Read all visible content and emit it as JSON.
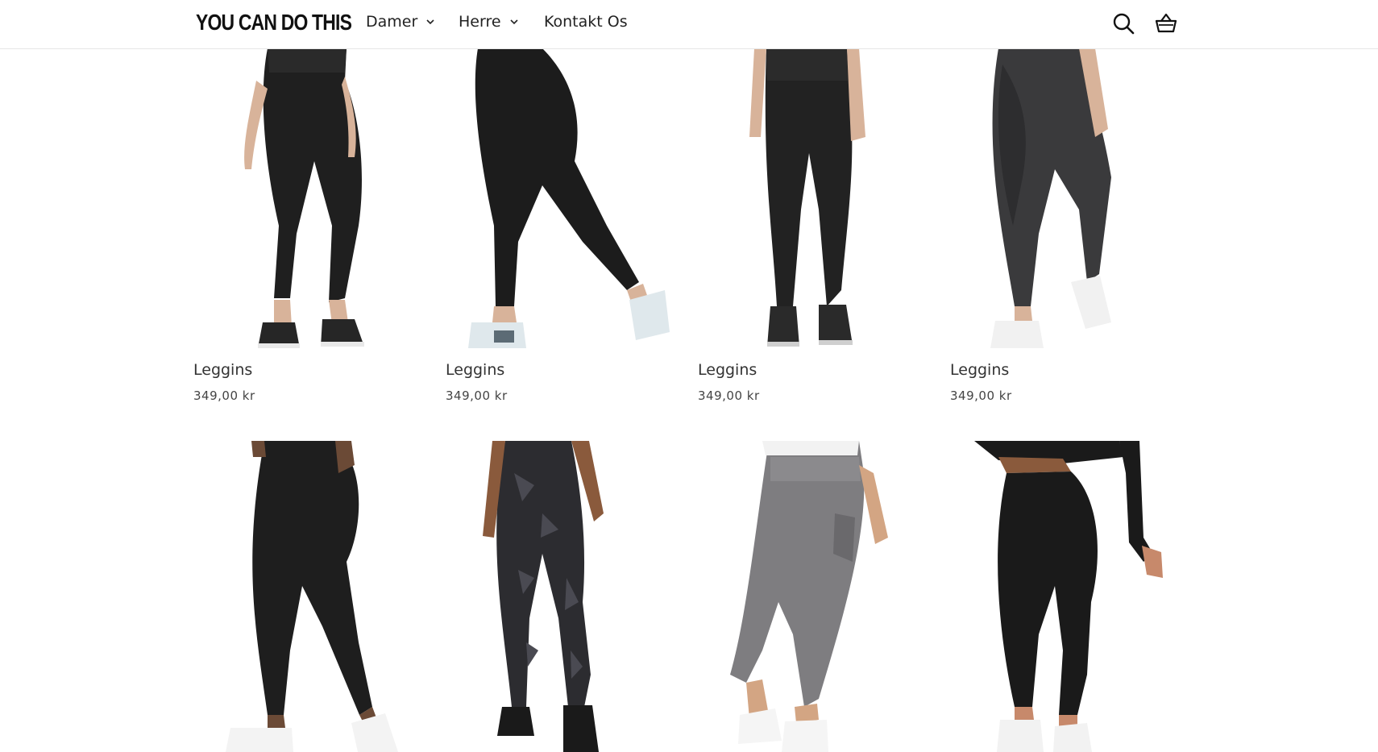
{
  "header": {
    "logo": "YOU CAN DO THIS",
    "nav": [
      {
        "label": "Damer"
      },
      {
        "label": "Herre"
      },
      {
        "label": "Kontakt Os"
      }
    ],
    "icons": [
      "search-icon",
      "basket-icon"
    ]
  },
  "products": [
    {
      "title": "Leggins",
      "price": "349,00 kr",
      "tone": "#1f1f1f"
    },
    {
      "title": "Leggins",
      "price": "349,00 kr",
      "tone": "#1c1c1c"
    },
    {
      "title": "Leggins",
      "price": "349,00 kr",
      "tone": "#222222"
    },
    {
      "title": "Leggins",
      "price": "349,00 kr",
      "tone": "#3a3a3c"
    },
    {
      "title": "",
      "price": "",
      "tone": "#1e1e1e"
    },
    {
      "title": "",
      "price": "",
      "tone": "#2c2c30"
    },
    {
      "title": "",
      "price": "",
      "tone": "#7e7d80"
    },
    {
      "title": "",
      "price": "",
      "tone": "#1a1a1a"
    }
  ]
}
